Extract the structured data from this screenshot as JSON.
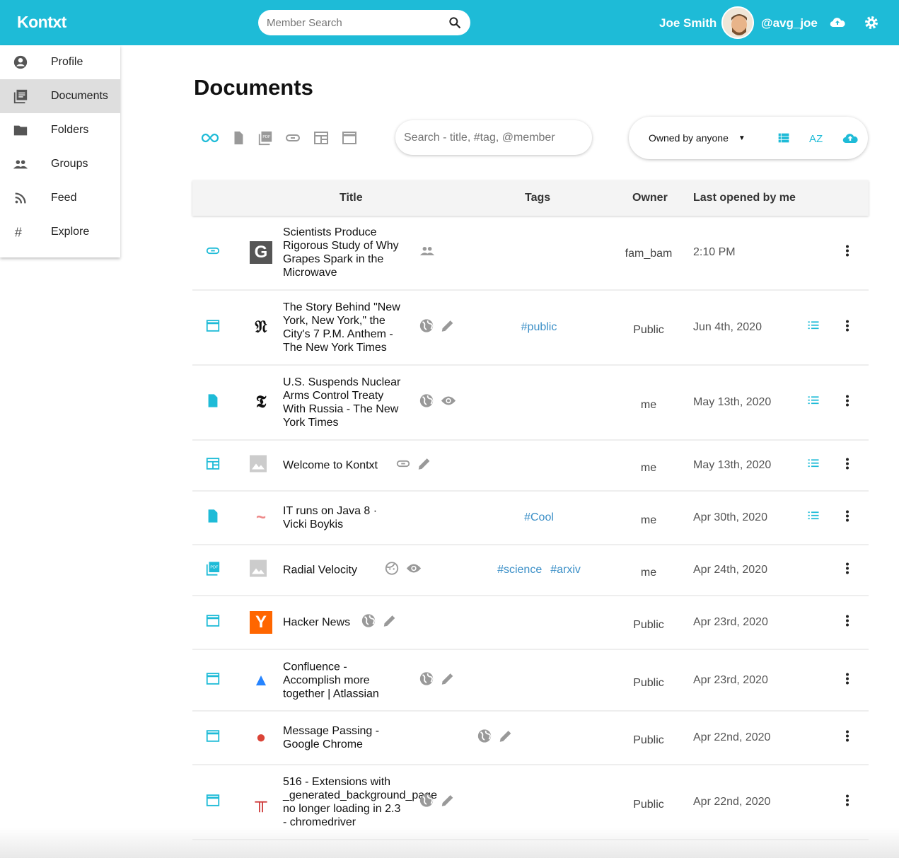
{
  "header": {
    "logo": "Kontxt",
    "search_placeholder": "Member Search",
    "user_name": "Joe Smith",
    "handle": "@avg_joe",
    "brand_color": "#1ebbd7"
  },
  "sidebar": {
    "items": [
      {
        "label": "Profile",
        "icon": "account-circle-icon"
      },
      {
        "label": "Documents",
        "icon": "library-books-icon",
        "active": true
      },
      {
        "label": "Folders",
        "icon": "folder-icon"
      },
      {
        "label": "Groups",
        "icon": "people-icon"
      },
      {
        "label": "Feed",
        "icon": "rss-icon"
      },
      {
        "label": "Explore",
        "icon": "hashtag-icon"
      }
    ]
  },
  "page": {
    "title": "Documents",
    "search_placeholder": "Search - title, #tag, @member",
    "owner_filter": "Owned by anyone"
  },
  "table": {
    "columns": [
      "Title",
      "Tags",
      "Owner",
      "Last opened by me"
    ],
    "rows": [
      {
        "type": "link",
        "favicon": "G",
        "fav_bg": "#555",
        "fav_fg": "#fff",
        "title": "Scientists Produce Rigorous Study of Why Grapes Spark in the Microwave",
        "share": [
          "group"
        ],
        "tags": [],
        "owner": "fam_bam",
        "date": "2:10 PM",
        "notes": false,
        "h": 106
      },
      {
        "type": "web",
        "favicon": "𝔑",
        "fav_bg": "#fff",
        "fav_fg": "#111",
        "title": "The Story Behind \"New York, New York,\" the City's 7 P.M. Anthem - The New York Times",
        "share": [
          "public",
          "edit"
        ],
        "tags": [
          "#public"
        ],
        "owner": "Public",
        "date": "Jun 4th, 2020",
        "notes": true,
        "h": 106
      },
      {
        "type": "doc",
        "favicon": "𝕿",
        "fav_bg": "#fff",
        "fav_fg": "#111",
        "title": "U.S. Suspends Nuclear Arms Control Treaty With Russia - The New York Times",
        "share": [
          "public",
          "view"
        ],
        "tags": [],
        "owner": "me",
        "date": "May 13th, 2020",
        "notes": true,
        "h": 106
      },
      {
        "type": "webclip",
        "favicon": "img",
        "fav_bg": "#ccc",
        "fav_fg": "#fff",
        "title": "Welcome to Kontxt",
        "share": [
          "link",
          "edit"
        ],
        "tags": [],
        "owner": "me",
        "date": "May 13th, 2020",
        "notes": true,
        "h": 72
      },
      {
        "type": "doc",
        "favicon": "~",
        "fav_bg": "#fff",
        "fav_fg": "#e88",
        "title": "IT runs on Java 8 · Vicki Boykis",
        "share": [],
        "tags": [
          "#Cool"
        ],
        "owner": "me",
        "date": "Apr 30th, 2020",
        "notes": true,
        "h": 76
      },
      {
        "type": "pdf",
        "favicon": "img",
        "fav_bg": "#ccc",
        "fav_fg": "#fff",
        "title": "Radial Velocity",
        "share": [
          "face",
          "view"
        ],
        "tags": [
          "#science",
          "#arxiv"
        ],
        "owner": "me",
        "date": "Apr 24th, 2020",
        "notes": false,
        "h": 72
      },
      {
        "type": "web",
        "favicon": "Y",
        "fav_bg": "#ff6600",
        "fav_fg": "#fff",
        "title": "Hacker News",
        "share": [
          "public",
          "edit"
        ],
        "tags": [],
        "owner": "Public",
        "date": "Apr 23rd, 2020",
        "notes": false,
        "h": 76
      },
      {
        "type": "web",
        "favicon": "▲",
        "fav_bg": "#fff",
        "fav_fg": "#2684ff",
        "title": "Confluence - Accomplish more together | Atlassian",
        "share": [
          "public",
          "edit"
        ],
        "tags": [],
        "owner": "Public",
        "date": "Apr 23rd, 2020",
        "notes": false,
        "h": 87
      },
      {
        "type": "web",
        "favicon": "●",
        "fav_bg": "#fff",
        "fav_fg": "#db4437",
        "title": "Message Passing - Google Chrome",
        "share": [
          "public",
          "edit"
        ],
        "tags": [],
        "owner": "Public",
        "date": "Apr 22nd, 2020",
        "notes": false,
        "h": 76
      },
      {
        "type": "web",
        "favicon": "╥",
        "fav_bg": "#fff",
        "fav_fg": "#c33",
        "title": "516 - Extensions with _generated_background_page no longer loading in 2.3 - chromedriver",
        "share": [
          "public",
          "edit"
        ],
        "tags": [],
        "owner": "Public",
        "date": "Apr 22nd, 2020",
        "notes": false,
        "h": 106
      }
    ]
  }
}
